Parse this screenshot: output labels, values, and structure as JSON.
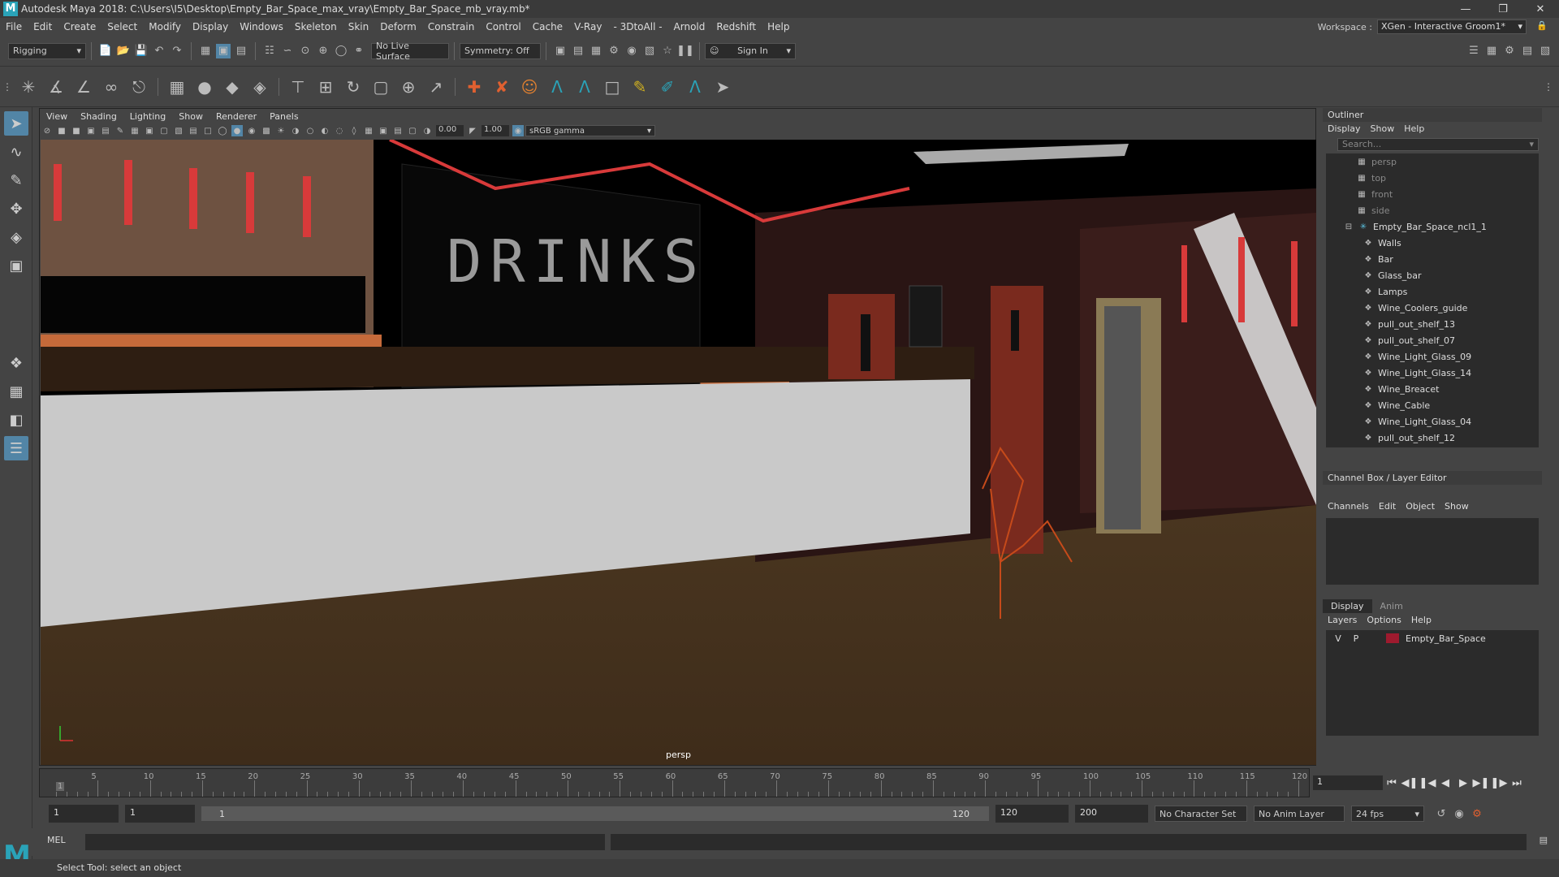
{
  "window": {
    "title": "Autodesk Maya 2018: C:\\Users\\I5\\Desktop\\Empty_Bar_Space_max_vray\\Empty_Bar_Space_mb_vray.mb*",
    "logo": "M"
  },
  "menu": [
    "File",
    "Edit",
    "Create",
    "Select",
    "Modify",
    "Display",
    "Windows",
    "Skeleton",
    "Skin",
    "Deform",
    "Constrain",
    "Control",
    "Cache",
    "V-Ray",
    "- 3DtoAll -",
    "Arnold",
    "Redshift",
    "Help"
  ],
  "workspace": {
    "label": "Workspace :",
    "value": "XGen - Interactive Groom1*"
  },
  "statusline": {
    "mode": "Rigging",
    "live_surface": "No Live Surface",
    "symmetry": "Symmetry: Off",
    "sign_in": "Sign In"
  },
  "viewport": {
    "menu": [
      "View",
      "Shading",
      "Lighting",
      "Show",
      "Renderer",
      "Panels"
    ],
    "exposure": "0.00",
    "gamma": "1.00",
    "color_space": "sRGB gamma",
    "camera": "persp",
    "sign_text": "DRINKS"
  },
  "outliner": {
    "title": "Outliner",
    "menu": [
      "Display",
      "Show",
      "Help"
    ],
    "search_placeholder": "Search...",
    "cameras": [
      "persp",
      "top",
      "front",
      "side"
    ],
    "root": "Empty_Bar_Space_ncl1_1",
    "children": [
      "Walls",
      "Bar",
      "Glass_bar",
      "Lamps",
      "Wine_Coolers_guide",
      "pull_out_shelf_13",
      "pull_out_shelf_07",
      "Wine_Light_Glass_09",
      "Wine_Light_Glass_14",
      "Wine_Breacet",
      "Wine_Cable",
      "Wine_Light_Glass_04",
      "pull_out_shelf_12"
    ]
  },
  "channelbox": {
    "title": "Channel Box / Layer Editor",
    "menu": [
      "Channels",
      "Edit",
      "Object",
      "Show"
    ]
  },
  "layereditor": {
    "tabs": [
      "Display",
      "Anim"
    ],
    "menu": [
      "Layers",
      "Options",
      "Help"
    ],
    "layer": {
      "v": "V",
      "p": "P",
      "name": "Empty_Bar_Space",
      "color": "#9e1a2e"
    }
  },
  "timeline": {
    "ticks": [
      "5",
      "10",
      "15",
      "20",
      "25",
      "30",
      "35",
      "40",
      "45",
      "50",
      "55",
      "60",
      "65",
      "70",
      "75",
      "80",
      "85",
      "90",
      "95",
      "100",
      "105",
      "110",
      "115",
      "120"
    ],
    "current": "1",
    "current_field": "1"
  },
  "range": {
    "start": "1",
    "anim_start": "1",
    "range_left": "1",
    "range_right": "120",
    "anim_end_a": "120",
    "anim_end_b": "200",
    "character_set": "No Character Set",
    "anim_layer": "No Anim Layer",
    "fps": "24 fps"
  },
  "cmdline": {
    "label": "MEL"
  },
  "helpline": {
    "text": "Select Tool: select an object"
  }
}
